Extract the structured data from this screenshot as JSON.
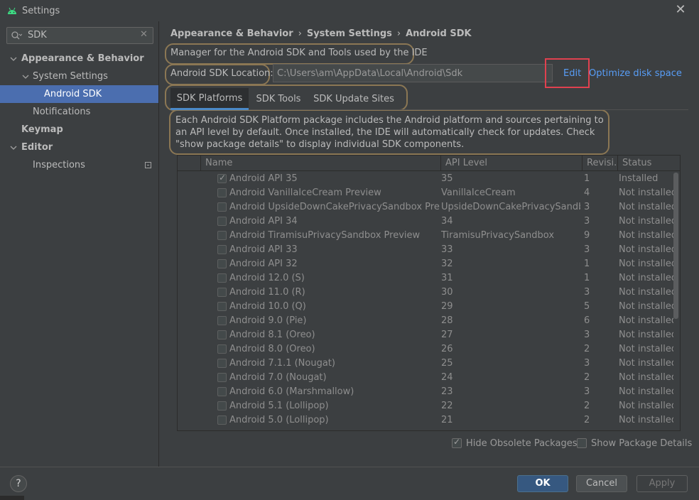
{
  "window": {
    "title": "Settings",
    "close": "✕"
  },
  "sidebar": {
    "search_value": "SDK",
    "search_clear": "✕",
    "items": [
      {
        "label": "Appearance & Behavior"
      },
      {
        "label": "System Settings"
      },
      {
        "label": "Android SDK"
      },
      {
        "label": "Notifications"
      },
      {
        "label": "Keymap"
      },
      {
        "label": "Editor"
      },
      {
        "label": "Inspections"
      }
    ]
  },
  "breadcrumb": {
    "items": [
      "Appearance & Behavior",
      "System Settings",
      "Android SDK"
    ],
    "separator": "›"
  },
  "header_description": "Manager for the Android SDK and Tools used by the IDE",
  "sdk_location": {
    "label": "Android SDK Location:",
    "value": "C:\\Users\\am\\AppData\\Local\\Android\\Sdk",
    "edit_label": "Edit",
    "optimize_label": "Optimize disk space"
  },
  "tabs": [
    {
      "label": "SDK Platforms",
      "active": true
    },
    {
      "label": "SDK Tools",
      "active": false
    },
    {
      "label": "SDK Update Sites",
      "active": false
    }
  ],
  "platforms_description": "Each Android SDK Platform package includes the Android platform and sources pertaining to an API level by default. Once installed, the IDE will automatically check for updates. Check \"show package details\" to display individual SDK components.",
  "table": {
    "columns": [
      "Name",
      "API Level",
      "Revisi...",
      "Status"
    ],
    "rows": [
      {
        "checked": true,
        "name": "Android API 35",
        "api": "35",
        "rev": "1",
        "status": "Installed"
      },
      {
        "checked": false,
        "name": "Android VanillaIceCream Preview",
        "api": "VanillaIceCream",
        "rev": "4",
        "status": "Not installed"
      },
      {
        "checked": false,
        "name": "Android UpsideDownCakePrivacySandbox Preview",
        "api": "UpsideDownCakePrivacySandbox",
        "rev": "3",
        "status": "Not installed"
      },
      {
        "checked": false,
        "name": "Android API 34",
        "api": "34",
        "rev": "3",
        "status": "Not installed"
      },
      {
        "checked": false,
        "name": "Android TiramisuPrivacySandbox Preview",
        "api": "TiramisuPrivacySandbox",
        "rev": "9",
        "status": "Not installed"
      },
      {
        "checked": false,
        "name": "Android API 33",
        "api": "33",
        "rev": "3",
        "status": "Not installed"
      },
      {
        "checked": false,
        "name": "Android API 32",
        "api": "32",
        "rev": "1",
        "status": "Not installed"
      },
      {
        "checked": false,
        "name": "Android 12.0 (S)",
        "api": "31",
        "rev": "1",
        "status": "Not installed"
      },
      {
        "checked": false,
        "name": "Android 11.0 (R)",
        "api": "30",
        "rev": "3",
        "status": "Not installed"
      },
      {
        "checked": false,
        "name": "Android 10.0 (Q)",
        "api": "29",
        "rev": "5",
        "status": "Not installed"
      },
      {
        "checked": false,
        "name": "Android 9.0 (Pie)",
        "api": "28",
        "rev": "6",
        "status": "Not installed"
      },
      {
        "checked": false,
        "name": "Android 8.1 (Oreo)",
        "api": "27",
        "rev": "3",
        "status": "Not installed"
      },
      {
        "checked": false,
        "name": "Android 8.0 (Oreo)",
        "api": "26",
        "rev": "2",
        "status": "Not installed"
      },
      {
        "checked": false,
        "name": "Android 7.1.1 (Nougat)",
        "api": "25",
        "rev": "3",
        "status": "Not installed"
      },
      {
        "checked": false,
        "name": "Android 7.0 (Nougat)",
        "api": "24",
        "rev": "2",
        "status": "Not installed"
      },
      {
        "checked": false,
        "name": "Android 6.0 (Marshmallow)",
        "api": "23",
        "rev": "3",
        "status": "Not installed"
      },
      {
        "checked": false,
        "name": "Android 5.1 (Lollipop)",
        "api": "22",
        "rev": "2",
        "status": "Not installed"
      },
      {
        "checked": false,
        "name": "Android 5.0 (Lollipop)",
        "api": "21",
        "rev": "2",
        "status": "Not installed"
      }
    ]
  },
  "options": {
    "hide_obsolete_label": "Hide Obsolete Packages",
    "hide_obsolete_checked": true,
    "show_details_label": "Show Package Details",
    "show_details_checked": false
  },
  "footer": {
    "help": "?",
    "ok": "OK",
    "cancel": "Cancel",
    "apply": "Apply"
  },
  "colors": {
    "accent": "#4b6eaf",
    "link": "#589df6",
    "highlight_box": "#e0414f",
    "annotation_outline": "#8b7754"
  }
}
